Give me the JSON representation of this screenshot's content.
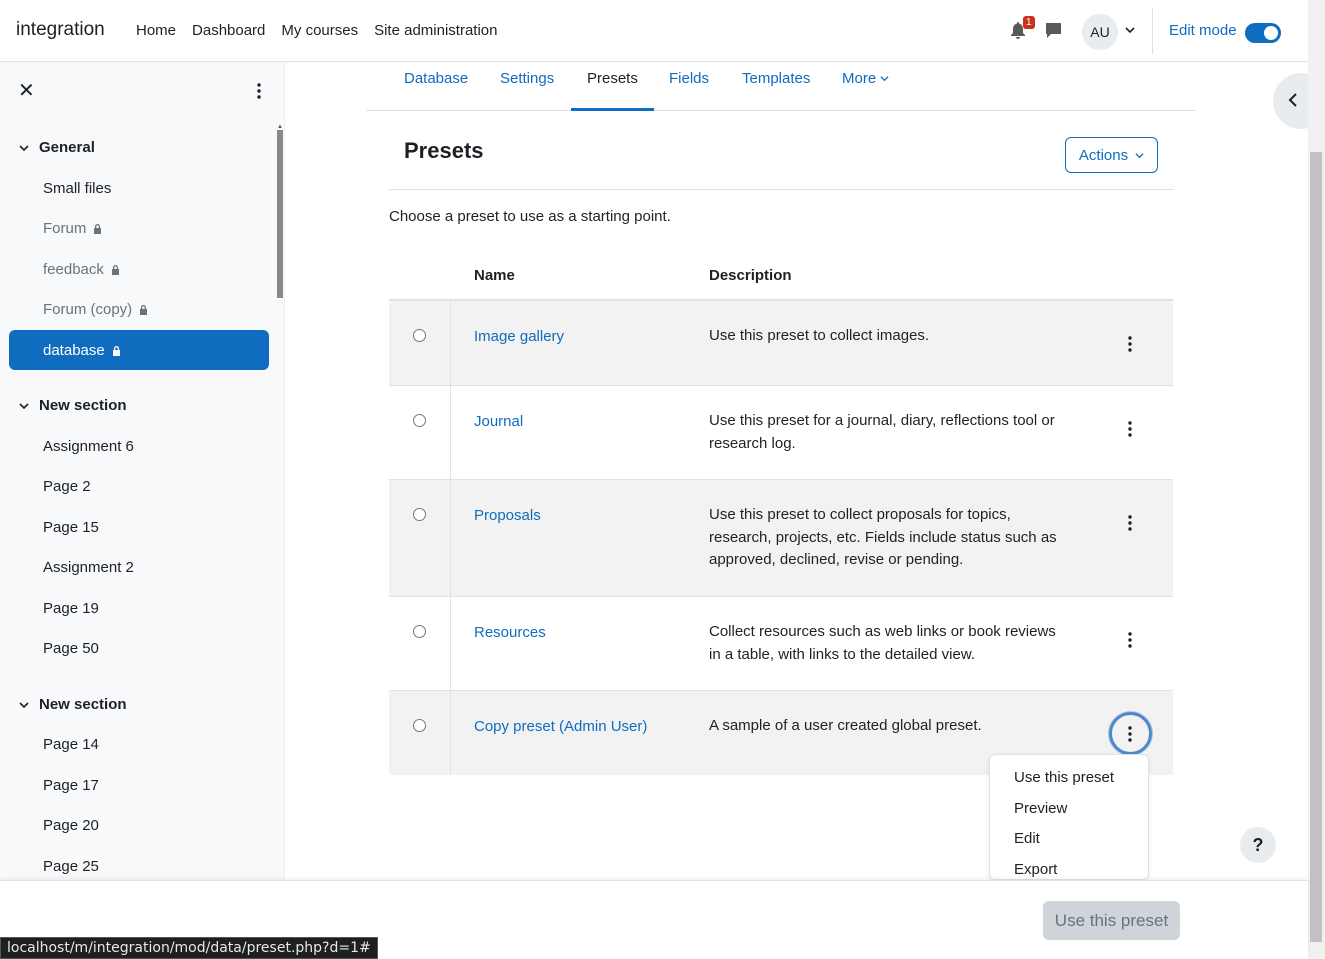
{
  "navbar": {
    "brand": "integration",
    "links": [
      "Home",
      "Dashboard",
      "My courses",
      "Site administration"
    ],
    "notification_count": "1",
    "avatar_initials": "AU",
    "edit_mode_label": "Edit mode",
    "edit_mode_on": true
  },
  "drawer": {
    "sections": [
      {
        "title": "General",
        "items": [
          {
            "label": "Small files",
            "locked": false
          },
          {
            "label": "Forum",
            "locked": true
          },
          {
            "label": "feedback",
            "locked": true
          },
          {
            "label": "Forum (copy)",
            "locked": true
          },
          {
            "label": "database",
            "locked": true,
            "active": true
          }
        ]
      },
      {
        "title": "New section",
        "items": [
          {
            "label": "Assignment 6"
          },
          {
            "label": "Page 2"
          },
          {
            "label": "Page 15"
          },
          {
            "label": "Assignment 2"
          },
          {
            "label": "Page 19"
          },
          {
            "label": "Page 50"
          }
        ]
      },
      {
        "title": "New section",
        "items": [
          {
            "label": "Page 14"
          },
          {
            "label": "Page 17"
          },
          {
            "label": "Page 20"
          },
          {
            "label": "Page 25"
          }
        ]
      }
    ]
  },
  "secondary_nav": {
    "tabs": [
      "Database",
      "Settings",
      "Presets",
      "Fields",
      "Templates",
      "More"
    ],
    "active": "Presets"
  },
  "main": {
    "title": "Presets",
    "actions_label": "Actions",
    "intro": "Choose a preset to use as a starting point.",
    "columns": [
      "Name",
      "Description"
    ],
    "rows": [
      {
        "name": "Image gallery",
        "desc": "Use this preset to collect images."
      },
      {
        "name": "Journal",
        "desc": "Use this preset for a journal, diary, reflections tool or research log."
      },
      {
        "name": "Proposals",
        "desc": "Use this preset to collect proposals for topics, research, projects, etc. Fields include status such as approved, declined, revise or pending."
      },
      {
        "name": "Resources",
        "desc": "Collect resources such as web links or book reviews in a table, with links to the detailed view."
      },
      {
        "name": "Copy preset (Admin User)",
        "desc": "A sample of a user created global preset."
      }
    ]
  },
  "dropdown": {
    "items": [
      "Use this preset",
      "Preview",
      "Edit",
      "Export"
    ]
  },
  "footer": {
    "use_button": "Use this preset"
  },
  "help_label": "?",
  "status_url": "localhost/m/integration/mod/data/preset.php?d=1#",
  "colors": {
    "accent": "#0f6cbf",
    "text": "#1d2125",
    "drawer_bg": "#f8f9fa",
    "badge": "#ca3120"
  }
}
